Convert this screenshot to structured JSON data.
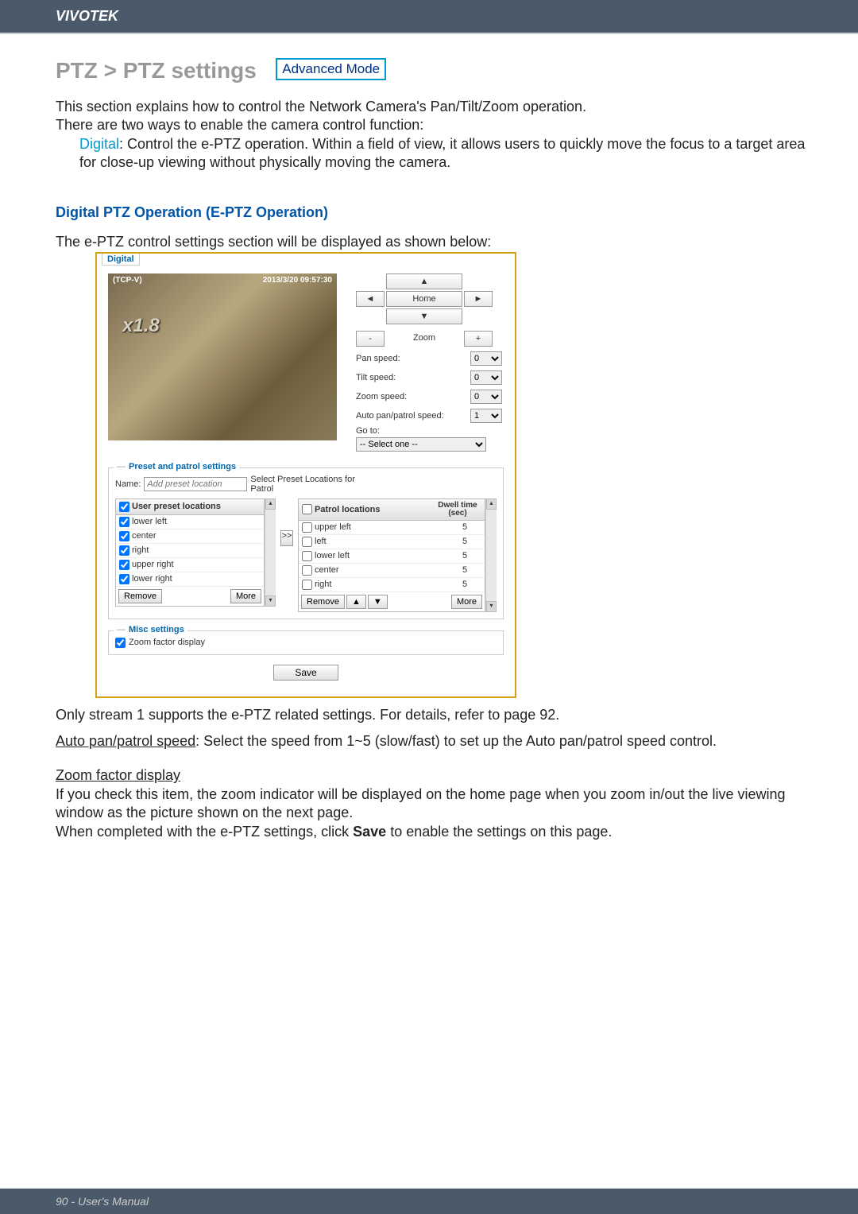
{
  "header": {
    "brand": "VIVOTEK"
  },
  "title": {
    "main": "PTZ > PTZ settings",
    "badge": "Advanced Mode"
  },
  "intro": {
    "p1": "This section explains how to control the Network Camera's Pan/Tilt/Zoom operation.",
    "p2": "There are two ways to enable the camera control function:",
    "digital_label": "Digital",
    "digital_desc": ": Control the e-PTZ operation. Within a field of view, it allows users to quickly move the focus to a target area for close-up viewing without physically moving the camera."
  },
  "section": {
    "title": "Digital PTZ Operation (E-PTZ Operation)",
    "sub": "The e-PTZ control settings section will be displayed as shown below:"
  },
  "ss": {
    "tab": "Digital",
    "video": {
      "source": "(TCP-V)",
      "timestamp": "2013/3/20 09:57:30",
      "zoom_overlay": "x1.8"
    },
    "nav": {
      "up": "▲",
      "left": "◄",
      "home": "Home",
      "right": "►",
      "down": "▼"
    },
    "zoom": {
      "out": "-",
      "label": "Zoom",
      "in": "+"
    },
    "speeds": {
      "pan_label": "Pan speed:",
      "pan_val": "0",
      "tilt_label": "Tilt speed:",
      "tilt_val": "0",
      "zoom_label": "Zoom speed:",
      "zoom_val": "0",
      "auto_label": "Auto pan/patrol speed:",
      "auto_val": "1"
    },
    "goto": {
      "label": "Go to:",
      "select": "-- Select one --"
    },
    "preset_legend": "Preset and patrol settings",
    "name_label": "Name:",
    "name_placeholder": "Add preset location",
    "select_hint": "Select Preset Locations for Patrol",
    "left_tbl": {
      "head": "User preset locations",
      "rows": [
        "lower left",
        "center",
        "right",
        "upper right",
        "lower right"
      ],
      "remove": "Remove",
      "more": "More"
    },
    "right_tbl": {
      "head": "Patrol locations",
      "dwell_head": "Dwell time (sec)",
      "rows": [
        {
          "loc": "upper left",
          "dwell": "5"
        },
        {
          "loc": "left",
          "dwell": "5"
        },
        {
          "loc": "lower left",
          "dwell": "5"
        },
        {
          "loc": "center",
          "dwell": "5"
        },
        {
          "loc": "right",
          "dwell": "5"
        }
      ],
      "remove": "Remove",
      "up": "▲",
      "down": "▼",
      "more": "More"
    },
    "xfer": ">>",
    "misc_legend": "Misc settings",
    "zoom_factor": "Zoom factor display",
    "save": "Save"
  },
  "post": {
    "stream": "Only stream 1 supports the e-PTZ related settings. For details, refer to page 92.",
    "auto_u": "Auto pan/patrol speed",
    "auto_txt": ": Select the speed from 1~5 (slow/fast) to set up the Auto pan/patrol speed control.",
    "zoom_u": "Zoom factor display",
    "zoom_p1": "If you check this item, the zoom indicator will be displayed on the home page when you zoom in/out the live viewing window as the picture shown on the next page.",
    "zoom_p2a": "When completed with the e-PTZ settings, click ",
    "zoom_bold": "Save",
    "zoom_p2b": " to enable the settings on this page."
  },
  "footer": {
    "text": "90 - User's Manual"
  }
}
